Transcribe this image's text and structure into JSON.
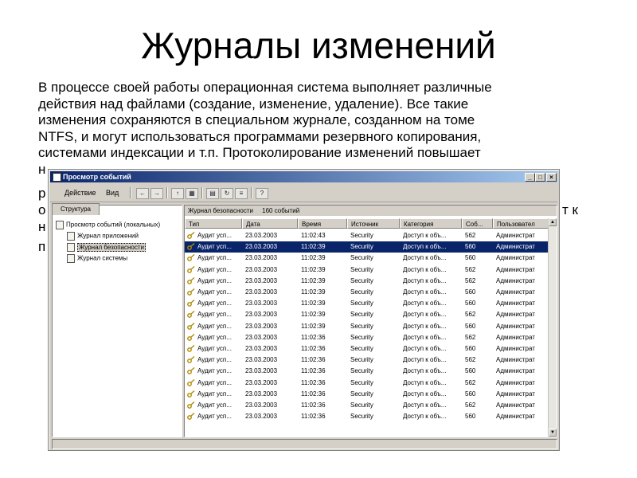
{
  "slide": {
    "title": "Журналы изменений",
    "paragraph_lines": [
      "В процессе своей работы операционная система выполняет различные",
      "действия над файлами (создание, изменение, удаление). Все такие",
      "изменения сохраняются в специальном журнале, созданном на томе",
      "NTFS, и могут использоваться программами резервного копирования,",
      "системами индексации и т.п. Протоколирование изменений повышает"
    ],
    "partial_left": [
      "н",
      "р",
      "о",
      "н",
      "п"
    ],
    "partial_right": [
      "т к"
    ]
  },
  "window": {
    "title": "Просмотр событий",
    "menu": [
      "Действие",
      "Вид"
    ],
    "toolbar_icons": [
      "back-arrow-icon",
      "forward-arrow-icon",
      "up-folder-icon",
      "show-hide-tree-icon",
      "properties-icon",
      "refresh-icon",
      "export-list-icon",
      "help-icon"
    ],
    "tree_tab": "Структура",
    "tree": {
      "root": "Просмотр событий (локальных)",
      "children": [
        "Журнал приложений",
        "Журнал безопасности",
        "Журнал системы"
      ],
      "selected_index": 1
    },
    "pane_header": {
      "log_name": "Журнал безопасности",
      "count": "160 событий"
    },
    "columns": [
      "Тип",
      "Дата",
      "Время",
      "Источник",
      "Категория",
      "Соб...",
      "Пользовател"
    ],
    "rows": [
      [
        "Аудит усп...",
        "23.03.2003",
        "11:02:43",
        "Security",
        "Доступ к объ...",
        "562",
        "Администрат"
      ],
      [
        "Аудит усп...",
        "23.03.2003",
        "11:02:39",
        "Security",
        "Доступ к объ...",
        "560",
        "Администрат"
      ],
      [
        "Аудит усп...",
        "23.03.2003",
        "11:02:39",
        "Security",
        "Доступ к объ...",
        "560",
        "Администрат"
      ],
      [
        "Аудит усп...",
        "23.03.2003",
        "11:02:39",
        "Security",
        "Доступ к объ...",
        "562",
        "Администрат"
      ],
      [
        "Аудит усп...",
        "23.03.2003",
        "11:02:39",
        "Security",
        "Доступ к объ...",
        "562",
        "Администрат"
      ],
      [
        "Аудит усп...",
        "23.03.2003",
        "11:02:39",
        "Security",
        "Доступ к объ...",
        "560",
        "Администрат"
      ],
      [
        "Аудит усп...",
        "23.03.2003",
        "11:02:39",
        "Security",
        "Доступ к объ...",
        "560",
        "Администрат"
      ],
      [
        "Аудит усп...",
        "23.03.2003",
        "11:02:39",
        "Security",
        "Доступ к объ...",
        "562",
        "Администрат"
      ],
      [
        "Аудит усп...",
        "23.03.2003",
        "11:02:39",
        "Security",
        "Доступ к объ...",
        "560",
        "Администрат"
      ],
      [
        "Аудит усп...",
        "23.03.2003",
        "11:02:36",
        "Security",
        "Доступ к объ...",
        "562",
        "Администрат"
      ],
      [
        "Аудит усп...",
        "23.03.2003",
        "11:02:36",
        "Security",
        "Доступ к объ...",
        "560",
        "Администрат"
      ],
      [
        "Аудит усп...",
        "23.03.2003",
        "11:02:36",
        "Security",
        "Доступ к объ...",
        "562",
        "Администрат"
      ],
      [
        "Аудит усп...",
        "23.03.2003",
        "11:02:36",
        "Security",
        "Доступ к объ...",
        "560",
        "Администрат"
      ],
      [
        "Аудит усп...",
        "23.03.2003",
        "11:02:36",
        "Security",
        "Доступ к объ...",
        "562",
        "Администрат"
      ],
      [
        "Аудит усп...",
        "23.03.2003",
        "11:02:36",
        "Security",
        "Доступ к объ...",
        "560",
        "Администрат"
      ],
      [
        "Аудит усп...",
        "23.03.2003",
        "11:02:36",
        "Security",
        "Доступ к объ...",
        "562",
        "Администрат"
      ],
      [
        "Аудит усп...",
        "23.03.2003",
        "11:02:36",
        "Security",
        "Доступ к объ...",
        "560",
        "Администрат"
      ]
    ],
    "selected_row": 1,
    "colors": {
      "titlebar_start": "#0a246a",
      "titlebar_end": "#a6caf0",
      "selection": "#0a246a",
      "face": "#d4d0c8"
    }
  }
}
